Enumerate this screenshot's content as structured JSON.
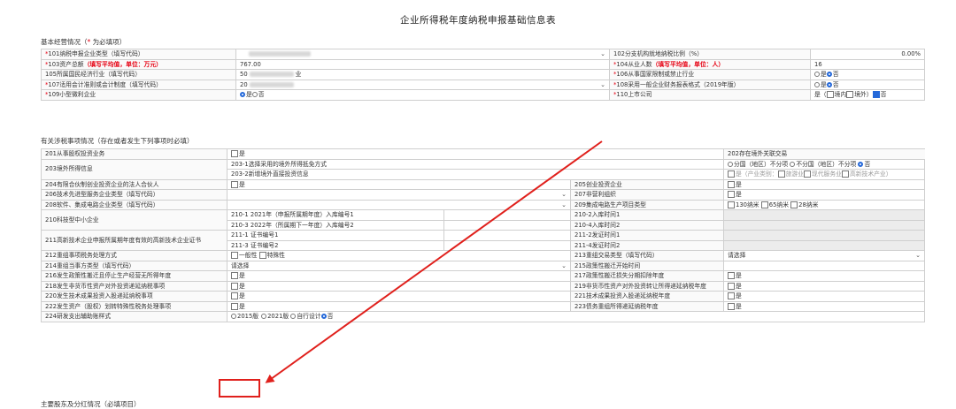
{
  "page_title": "企业所得税年度纳税申报基础信息表",
  "section1": {
    "title": "基本经营情况（",
    "required_mark": "*",
    "required_text": "为必填项）"
  },
  "basic": {
    "r1": {
      "label": "101纳税申报企业类型（填写代码）",
      "label2": "102分支机构就地纳税比例（%）",
      "value2": "0.00%"
    },
    "r2": {
      "label": "103资产总额",
      "hint": "（填写平均值，单位：万元）",
      "value": "767.00",
      "label2": "104从业人数",
      "hint2": "（填写平均值，单位：人）",
      "value2": "16"
    },
    "r3": {
      "label": "105所属国民经济行业（填写代码）",
      "value": "50",
      "value_tail": "业",
      "label2": "106从事国家限制或禁止行业",
      "yes": "是",
      "no": "否"
    },
    "r4": {
      "label": "107适用会计准则或会计制度（填写代码）",
      "value": "20",
      "label2": "108采用一般企业财务报表格式（2019年版）",
      "yes": "是",
      "no": "否"
    },
    "r5": {
      "label": "109小型微利企业",
      "yes": "是",
      "no": "否",
      "label2": "110上市公司",
      "yes2": "是（",
      "in": "境内",
      "out": "境外）",
      "no2": "否"
    }
  },
  "section2": {
    "title": "有关涉税事项情况（存在或者发生下列事项时必填）"
  },
  "matters": {
    "r201": {
      "label": "201从事股权投资业务",
      "opt": "是",
      "label2": "202存在境外关联交易",
      "opt2": "是"
    },
    "r203": {
      "label": "203境外所得信息",
      "sub1": "203-1选择采用的境外所得抵免方式",
      "sub2": "203-2新增境外直接投资信息",
      "opt1a": "分国（地区）不分项",
      "opt1b": "不分国（地区）不分项",
      "opt1c": "否",
      "opt2": "是（产业类别：",
      "opt2a": "旅游业",
      "opt2b": "现代服务业",
      "opt2c": "高新技术产业）"
    },
    "r204": {
      "label": "204有限合伙制创业投资企业的法人合伙人",
      "opt": "是",
      "label2": "205创业投资企业",
      "opt2": "是"
    },
    "r206": {
      "label": "206技术先进型服务企业类型（填写代码）",
      "label2": "207非营利组织",
      "opt2": "是"
    },
    "r208": {
      "label": "208软件、集成电路企业类型（填写代码）",
      "label2": "209集成电路生产项目类型",
      "opt_a": "130纳米",
      "opt_b": "65纳米",
      "opt_c": "28纳米"
    },
    "r210": {
      "label": "210科技型中小企业",
      "sub1": "210-1 2021年（申报所属期年度）入库编号1",
      "sub2": "210-3 2022年（所属期下一年度）入库编号2",
      "label_t1": "210-2入库时间1",
      "label_t2": "210-4入库时间2"
    },
    "r211": {
      "label": "211高新技术企业申报所属期年度有效的高新技术企业证书",
      "sub1": "211-1 证书编号1",
      "sub2": "211-3 证书编号2",
      "label_t1": "211-2发证时间1",
      "label_t2": "211-4发证时间2"
    },
    "r212": {
      "label": "212重组事项税务处理方式",
      "opt_a": "一般性",
      "opt_b": "特殊性",
      "label2": "213重组交易类型（填写代码）",
      "select2": "请选择"
    },
    "r214": {
      "label": "214重组当事方类型（填写代码）",
      "select": "请选择",
      "label2": "215政策性搬迁开始时间"
    },
    "r216": {
      "label": "216发生政策性搬迁且停止生产经营无所得年度",
      "opt": "是",
      "label2": "217政策性搬迁损失分期扣除年度",
      "opt2": "是"
    },
    "r218": {
      "label": "218发生非货币性资产对外投资递延纳税事项",
      "opt": "是",
      "label2": "219非货币性资产对外投资转让所得递延纳税年度",
      "opt2": "是"
    },
    "r220": {
      "label": "220发生技术成果投资入股递延纳税事项",
      "opt": "是",
      "label2": "221技术成果投资入股递延纳税年度",
      "opt2": "是"
    },
    "r222": {
      "label": "222发生资产（股权）划转特殊性税务处理事项",
      "opt": "是",
      "label2": "223债务重组所得递延纳税年度",
      "opt2": "是"
    },
    "r224": {
      "label": "224研发支出辅助账样式",
      "opt_a": "2015版",
      "opt_b": "2021版",
      "opt_c": "自行设计",
      "opt_d": "否"
    }
  },
  "section3": {
    "title": "主要股东及分红情况（必填项目）"
  },
  "annotation": {
    "color": "#e0201c"
  }
}
